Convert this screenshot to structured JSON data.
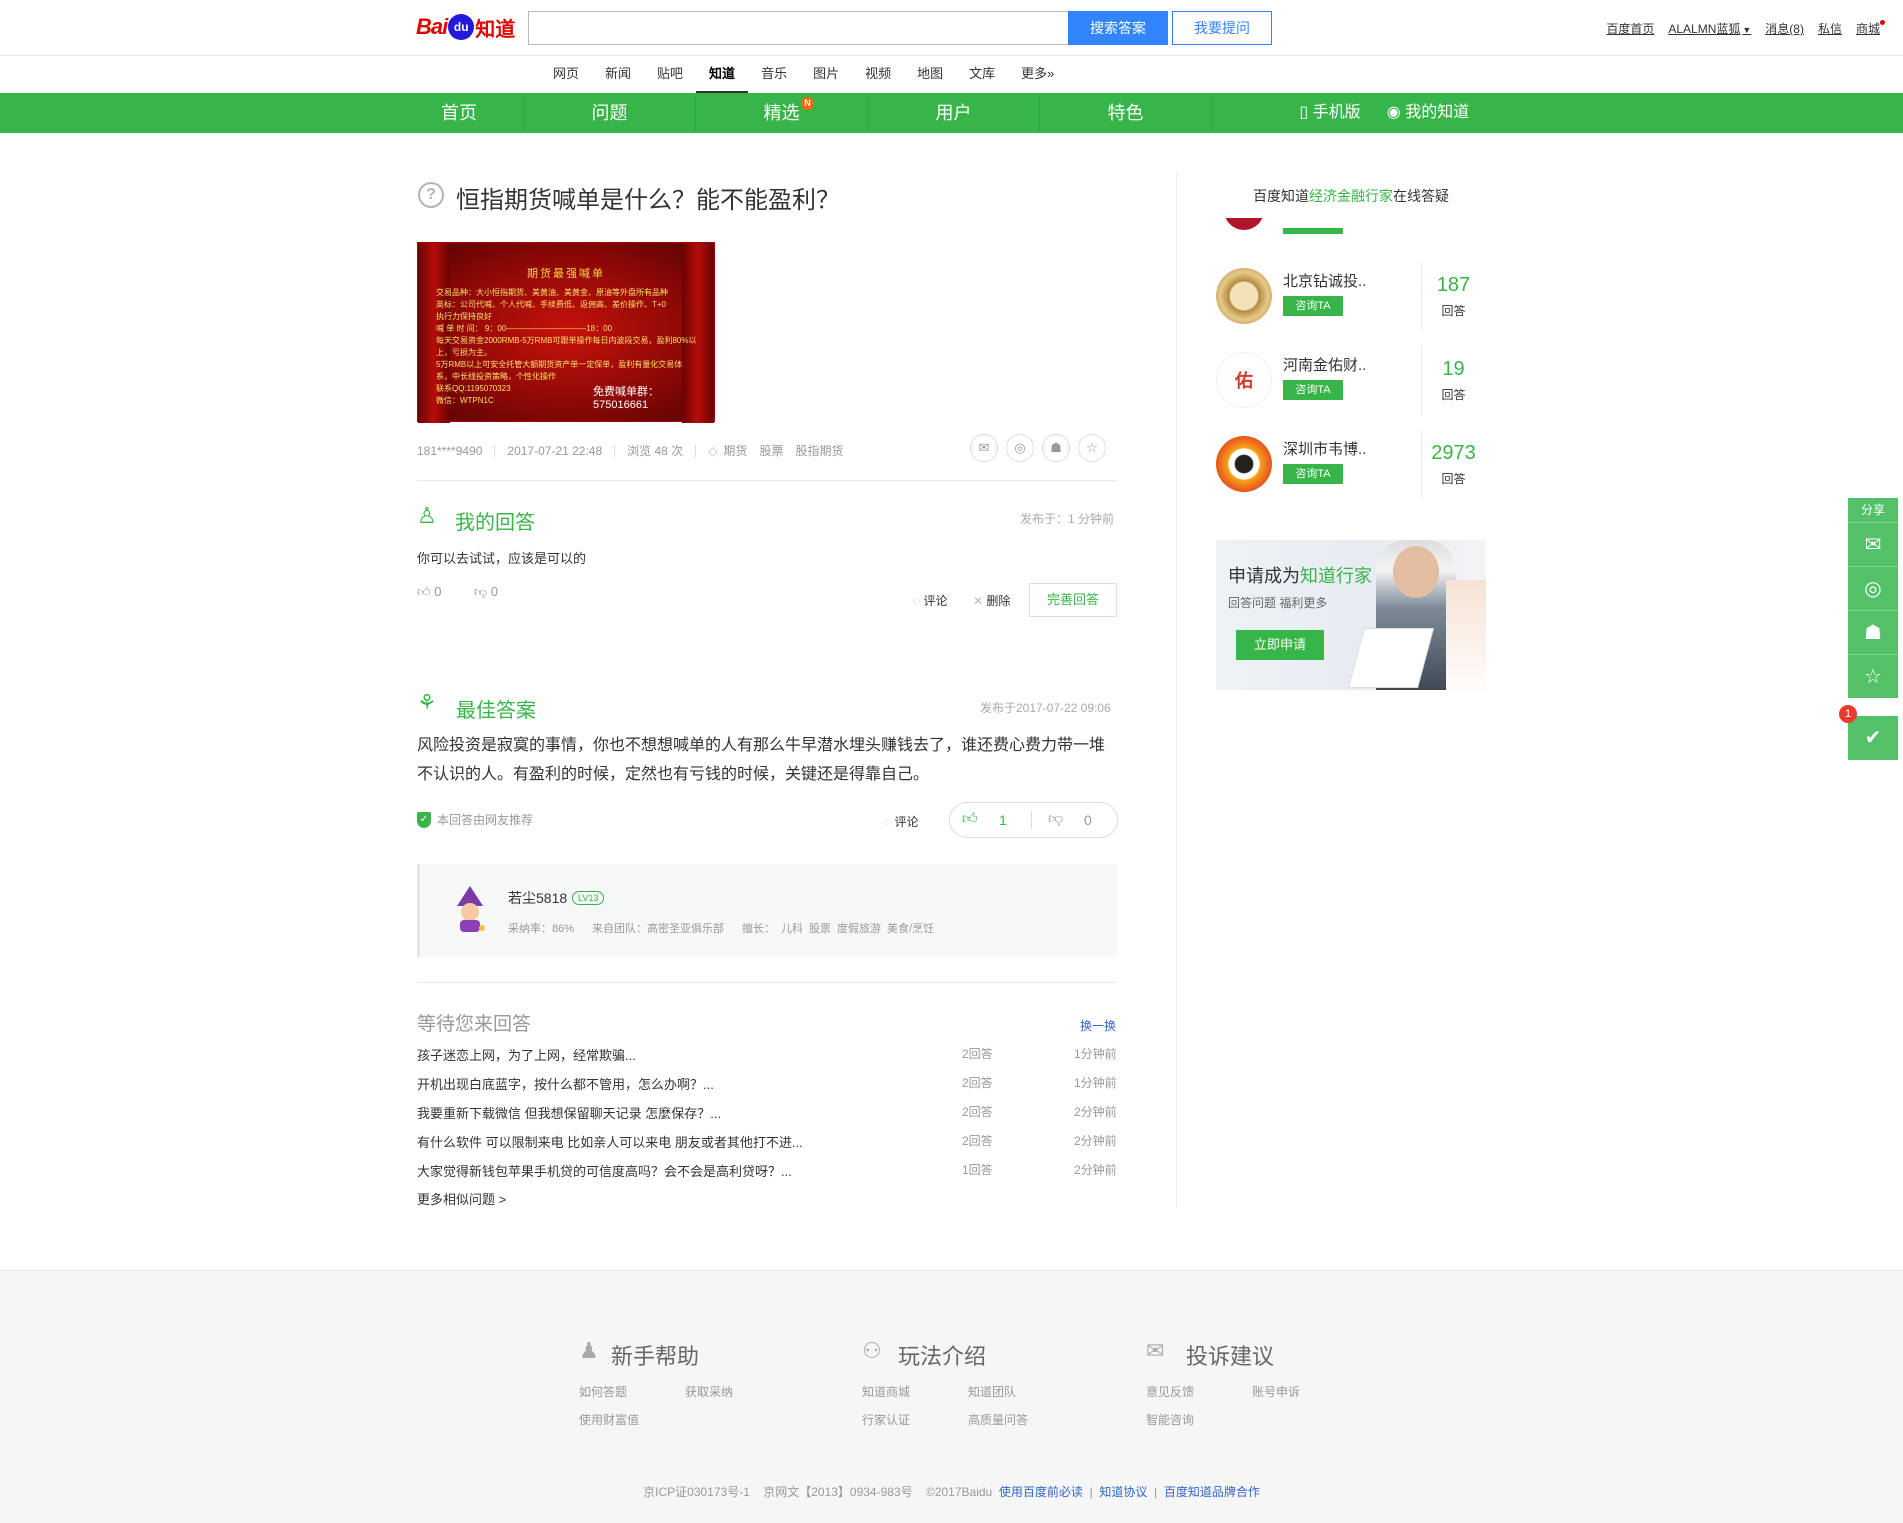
{
  "header": {
    "logo": {
      "bai": "Bai",
      "du": "du",
      "zhidao": "知道"
    },
    "search_placeholder": "",
    "search_button": "搜索答案",
    "ask_button": "我要提问",
    "user_links": [
      "百度首页",
      "ALALMN蓝狐",
      "消息(8)",
      "私信",
      "商城"
    ]
  },
  "subnav": {
    "items": [
      "网页",
      "新闻",
      "贴吧",
      "知道",
      "音乐",
      "图片",
      "视频",
      "地图",
      "文库",
      "更多»"
    ],
    "active": "知道"
  },
  "greenbar": {
    "items": [
      "首页",
      "问题",
      "精选",
      "用户",
      "特色"
    ],
    "badge": "N",
    "mobile": "手机版",
    "my_zhidao": "我的知道"
  },
  "question": {
    "title": "恒指期货喊单是什么？能不能盈利？",
    "image": {
      "heading": "期货最强喊单",
      "lines": [
        "交易品种：大小恒指期货、美黄油、美黄金、原油等外盘所有品种",
        "英标：公司代喊、个人代喊、手续费低、返佣高、差价操作、T+0",
        "执行力保持良好",
        "喊 单 时 间： 9：00——————————18：00",
        "每天交易资金2000RMB-5万RMB可跟单操作每日内波段交易，盈利80%以",
        "上，亏损为主。",
        "5万RMB以上可安全托管大额期货资产单一定保单，盈利有量化交易体",
        "系，中长线投资策略，个性化操作"
      ],
      "qq": "联系QQ:1195070323",
      "free": "免费喊单群：575016661",
      "wx": "微信：WTPN1C"
    },
    "meta": {
      "user": "181****9490",
      "date": "2017-07-21 22:48",
      "views": "浏览 48 次",
      "tags": [
        "期货",
        "股票",
        "股指期货"
      ]
    }
  },
  "my_answer": {
    "title": "我的回答",
    "time": "发布于：1 分钟前",
    "text": "你可以去试试，应该是可以的",
    "up": "0",
    "down": "0",
    "comment": "评论",
    "delete": "删除",
    "complete": "完善回答"
  },
  "best_answer": {
    "title": "最佳答案",
    "time": "发布于2017-07-22 09:06",
    "text": "风险投资是寂寞的事情，你也不想想喊单的人有那么牛早潜水埋头赚钱去了，谁还费心费力带一堆不认识的人。有盈利的时候，定然也有亏钱的时候，关键还是得靠自己。",
    "recommend": "本回答由网友推荐",
    "comment": "评论",
    "up": "1",
    "down": "0",
    "user": {
      "name": "若尘5818",
      "level": "LV13",
      "adopt": "采纳率：86%",
      "team": "来自团队：高密圣亚俱乐部",
      "expert_label": "擅长：",
      "expertise": [
        "儿科",
        "股票",
        "度假旅游",
        "美食/烹饪"
      ]
    }
  },
  "waiting": {
    "title": "等待您来回答",
    "swap": "换一换",
    "questions": [
      {
        "q": "孩子迷恋上网，为了上网，经常欺骗...",
        "count": "2回答",
        "time": "1分钟前"
      },
      {
        "q": "开机出现白底蓝字，按什么都不管用，怎么办啊？...",
        "count": "2回答",
        "time": "1分钟前"
      },
      {
        "q": "我要重新下载微信 但我想保留聊天记录 怎麼保存？...",
        "count": "2回答",
        "time": "2分钟前"
      },
      {
        "q": "有什么软件 可以限制来电 比如亲人可以来电 朋友或者其他打不进...",
        "count": "2回答",
        "time": "2分钟前"
      },
      {
        "q": "大家觉得新钱包苹果手机贷的可信度高吗？会不会是高利贷呀？...",
        "count": "1回答",
        "time": "2分钟前"
      }
    ],
    "more": "更多相似问题 >"
  },
  "sidebar": {
    "head_prefix": "百度知道",
    "head_highlight": "经济金融行家",
    "head_suffix": "在线答疑",
    "experts": [
      {
        "name": "北京钻诚投..",
        "button": "咨询TA",
        "count": "187",
        "label": "回答",
        "color": "#b38a3c"
      },
      {
        "name": "河南金佑财..",
        "button": "咨询TA",
        "count": "19",
        "label": "回答",
        "color": "#d23a2a"
      },
      {
        "name": "深圳市韦博..",
        "button": "咨询TA",
        "count": "2973",
        "label": "回答",
        "color": "#f26b1d"
      }
    ],
    "banner": {
      "prefix": "申请成为",
      "highlight": "知道行家",
      "sub": "回答问题  福利更多",
      "button": "立即申请"
    }
  },
  "float": {
    "share": "分享",
    "todo_badge": "1"
  },
  "footer": {
    "columns": [
      {
        "title": "新手帮助",
        "icon": "user-icon",
        "links": [
          "如何答题",
          "获取采纳",
          "使用财富值"
        ]
      },
      {
        "title": "玩法介绍",
        "icon": "network-icon",
        "links": [
          "知道商城",
          "知道团队",
          "行家认证",
          "高质量问答"
        ]
      },
      {
        "title": "投诉建议",
        "icon": "mail-icon",
        "links": [
          "意见反馈",
          "账号申诉",
          "智能咨询"
        ]
      }
    ],
    "icp": "京ICP证030173号-1",
    "wenwang": "京网文【2013】0934-983号",
    "copy": "©2017Baidu",
    "links": [
      "使用百度前必读",
      "知道协议",
      "百度知道品牌合作"
    ]
  },
  "colors": {
    "green": "#38b549",
    "blue": "#3385ff",
    "red": "#e10601"
  }
}
